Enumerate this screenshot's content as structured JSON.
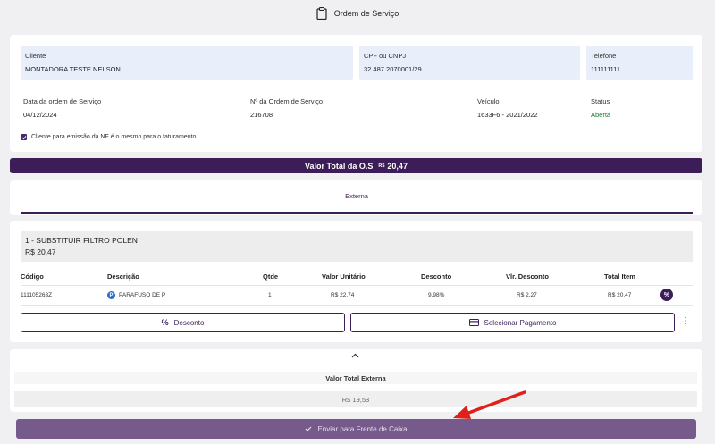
{
  "header": {
    "title": "Ordem de Serviço"
  },
  "client": {
    "cliente_label": "Cliente",
    "cliente_value": "MONTADORA TESTE NELSON",
    "cpf_label": "CPF ou CNPJ",
    "cpf_value": "32.487.2070001/29",
    "telefone_label": "Telefone",
    "telefone_value": "111111111",
    "data_label": "Data da ordem de Serviço",
    "data_value": "04/12/2024",
    "numero_label": "Nº da Ordem de Serviço",
    "numero_value": "216708",
    "veiculo_label": "Veículo",
    "veiculo_value": "1633F6 - 2021/2022",
    "status_label": "Status",
    "status_value": "Aberta",
    "checkbox_label": "Cliente para emissão da NF é o mesmo para o faturamento."
  },
  "total": {
    "label": "Valor Total da O.S",
    "currency": "R$",
    "value": "20,47"
  },
  "tabs": [
    {
      "label": "Externa"
    }
  ],
  "service": {
    "title": "1 - SUBSTITUIR FILTRO POLEN",
    "price": "R$ 20,47",
    "columns": [
      "Código",
      "Descrição",
      "Qtde",
      "Valor Unitário",
      "Desconto",
      "Vlr. Desconto",
      "Total Item"
    ],
    "rows": [
      {
        "codigo": "11110526​3Z",
        "descricao": "PARAFUSO DE P",
        "qtde": "1",
        "valor_unitario": "R$ 22,74",
        "desconto": "9,98%",
        "vlr_desconto": "R$ 2,27",
        "total_item": "R$ 20,47"
      }
    ],
    "desconto_button": "Desconto",
    "pagamento_button": "Selecionar Pagamento"
  },
  "summary": {
    "label": "Valor Total Externa",
    "value": "R$ 19,53"
  },
  "send_button": "Enviar para Frente de Caixa",
  "colors": {
    "primary": "#3c1d58",
    "status": "#1e7a36",
    "info_bg": "#e8eefa",
    "arrow": "#e0201a"
  }
}
